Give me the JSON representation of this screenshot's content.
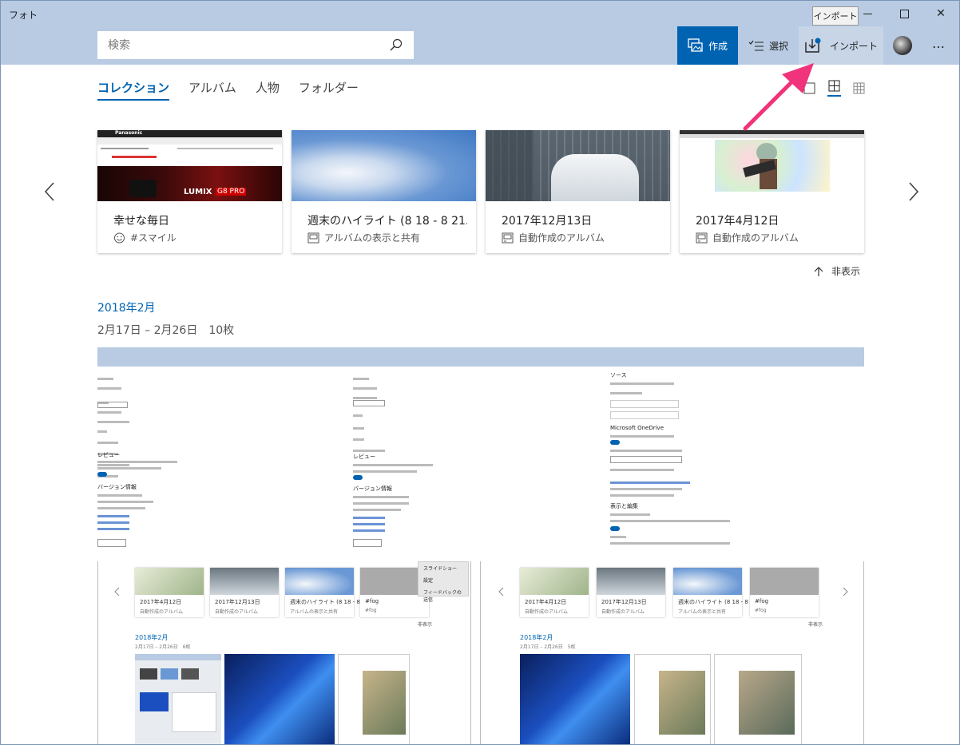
{
  "window": {
    "title": "フォト"
  },
  "tooltip": "インポート",
  "search": {
    "placeholder": "検索"
  },
  "commands": {
    "create": "作成",
    "select": "選択",
    "import": "インポート",
    "more": "…"
  },
  "tabs": [
    {
      "label": "コレクション",
      "active": true
    },
    {
      "label": "アルバム",
      "active": false
    },
    {
      "label": "人物",
      "active": false
    },
    {
      "label": "フォルダー",
      "active": false
    }
  ],
  "cards": [
    {
      "title": "幸せな毎日",
      "subtitle": "#スマイル",
      "icon": "smiley-icon"
    },
    {
      "title": "週末のハイライト (8 18 - 8 21...",
      "subtitle": "アルバムの表示と共有",
      "icon": "album-icon"
    },
    {
      "title": "2017年12月13日",
      "subtitle": "自動作成のアルバム",
      "icon": "auto-album-icon"
    },
    {
      "title": "2017年4月12日",
      "subtitle": "自動作成のアルバム",
      "icon": "auto-album-icon"
    }
  ],
  "thumb_text": {
    "lumix": "LUMIX",
    "gs": "G8 PRO",
    "brand": "Panasonic"
  },
  "hide_label": "非表示",
  "section": {
    "month": "2018年2月",
    "range": "2月17日 – 2月26日　10枚"
  },
  "shots": {
    "ms_onedrive": "Microsoft OneDrive",
    "source": "ソース",
    "review": "レビュー",
    "version": "バージョン情報",
    "display": "表示と編集"
  },
  "mini": {
    "card1": "2017年4月12日",
    "card2": "2017年12月13日",
    "card3": "週末のハイライト (8 18 - 8 21...",
    "card4": "#fog",
    "sub_auto": "自動作成のアルバム",
    "sub_album": "アルバムの表示と共有",
    "sub_fog": "#fog",
    "section": "2018年2月",
    "range_a": "2月17日 – 2月26日　6枚",
    "range_b": "2月17日 – 2月26日　5枚",
    "hide": "非表示",
    "menu": [
      "スライドショー",
      "設定",
      "フィードバックの送信"
    ]
  },
  "colors": {
    "accent": "#0063b1",
    "header": "#b8cbe3",
    "arrow": "#f0337a"
  }
}
